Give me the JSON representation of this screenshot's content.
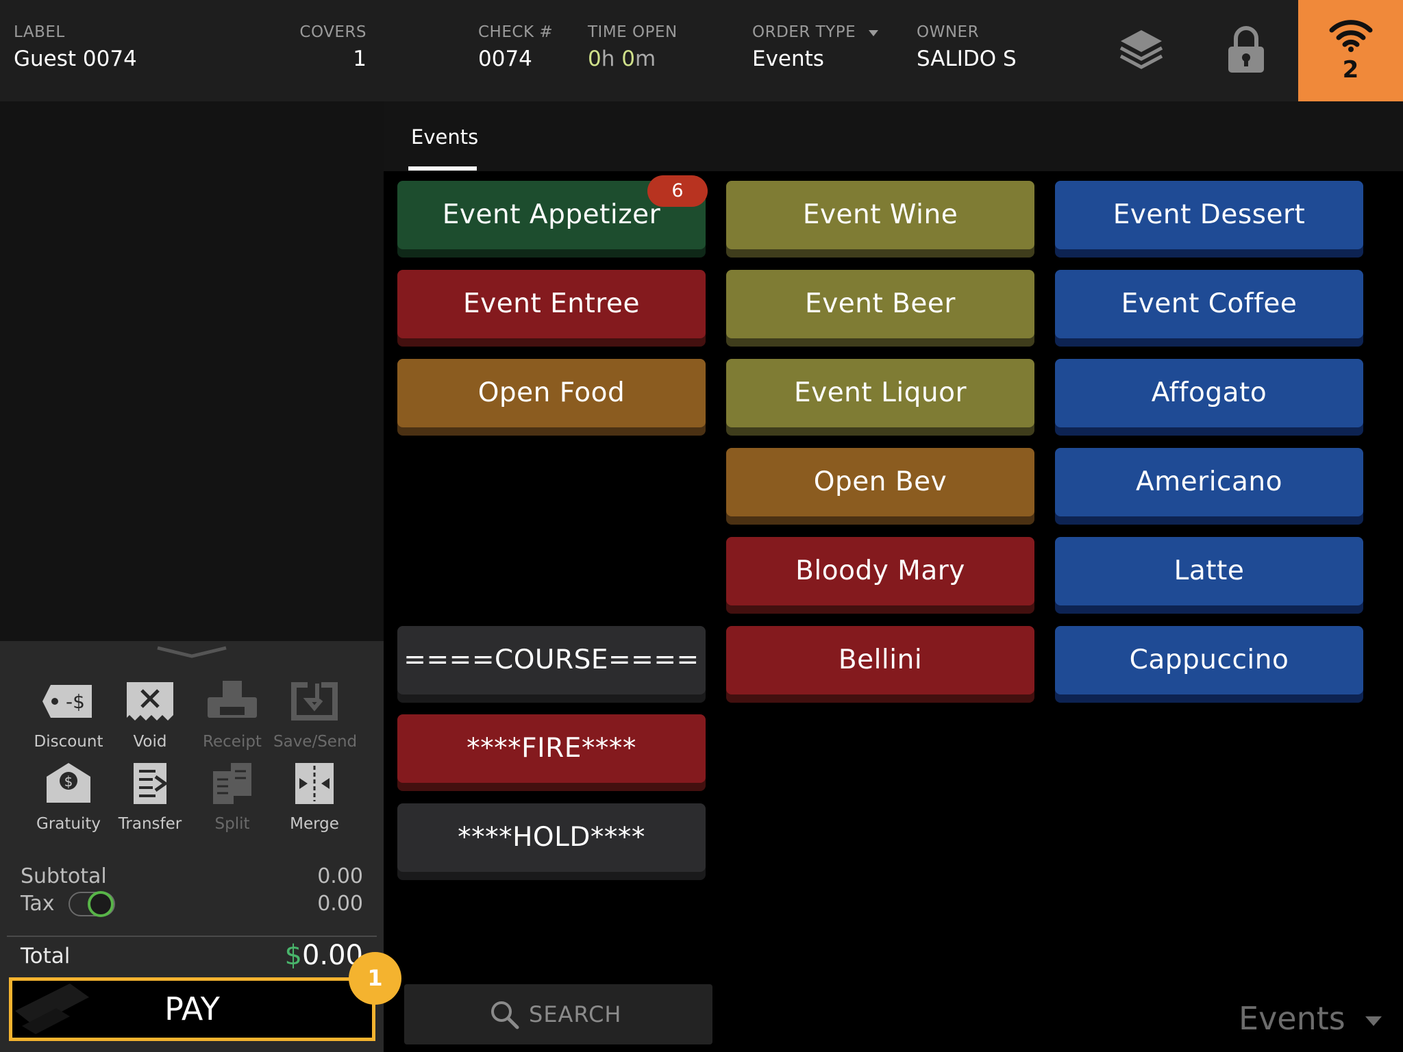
{
  "header": {
    "label": {
      "title": "LABEL",
      "value": "Guest 0074"
    },
    "covers": {
      "title": "COVERS",
      "value": "1"
    },
    "check": {
      "title": "CHECK #",
      "value": "0074"
    },
    "time_open": {
      "title": "TIME OPEN",
      "hours": "0",
      "hours_unit": "h",
      "minutes": "0",
      "minutes_unit": "m"
    },
    "order_type": {
      "title": "ORDER TYPE",
      "value": "Events"
    },
    "owner": {
      "title": "OWNER",
      "value": "SALIDO S"
    },
    "alert_count": "2",
    "icons": [
      "layers-icon",
      "lock-icon",
      "wifi-icon"
    ],
    "alert_color": "#f0893a"
  },
  "tools": [
    {
      "label": "Discount",
      "icon": "discount-tag-icon",
      "enabled": true
    },
    {
      "label": "Void",
      "icon": "void-receipt-icon",
      "enabled": true
    },
    {
      "label": "Receipt",
      "icon": "printer-icon",
      "enabled": false
    },
    {
      "label": "Save/Send",
      "icon": "save-send-icon",
      "enabled": false
    },
    {
      "label": "Gratuity",
      "icon": "gratuity-envelope-icon",
      "enabled": true
    },
    {
      "label": "Transfer",
      "icon": "transfer-icon",
      "enabled": true
    },
    {
      "label": "Split",
      "icon": "split-icon",
      "enabled": false
    },
    {
      "label": "Merge",
      "icon": "merge-icon",
      "enabled": true
    }
  ],
  "summary": {
    "subtotal_label": "Subtotal",
    "subtotal_value": "0.00",
    "tax_label": "Tax",
    "tax_value": "0.00",
    "tax_toggle_on": true,
    "total_label": "Total",
    "total_currency": "$",
    "total_value": "0.00"
  },
  "pay_label": "PAY",
  "step_badge": "1",
  "tabs": [
    {
      "label": "Events",
      "active": true
    }
  ],
  "items": [
    {
      "label": "Event Appetizer",
      "color": "green",
      "badge": "6"
    },
    {
      "label": "Event Wine",
      "color": "olive"
    },
    {
      "label": "Event Dessert",
      "color": "blue"
    },
    {
      "label": "Event Entree",
      "color": "red"
    },
    {
      "label": "Event Beer",
      "color": "olive"
    },
    {
      "label": "Event Coffee",
      "color": "blue"
    },
    {
      "label": "Open Food",
      "color": "orange"
    },
    {
      "label": "Event Liquor",
      "color": "olive"
    },
    {
      "label": "Affogato",
      "color": "blue"
    },
    {
      "label": "Open Bev",
      "color": "orange"
    },
    {
      "label": "Americano",
      "color": "blue"
    },
    {
      "label": "Bloody Mary",
      "color": "red"
    },
    {
      "label": "Latte",
      "color": "blue"
    },
    {
      "label": "====COURSE====",
      "color": "dark"
    },
    {
      "label": "Bellini",
      "color": "red"
    },
    {
      "label": "Cappuccino",
      "color": "blue"
    },
    {
      "label": "****FIRE****",
      "color": "red"
    },
    {
      "label": "****HOLD****",
      "color": "dark"
    }
  ],
  "search": {
    "placeholder": "SEARCH"
  },
  "menu_selector": "Events",
  "colors": {
    "pay_border": "#f4b32f",
    "currency_green": "#49b56b",
    "badge_red": "#b83320"
  }
}
